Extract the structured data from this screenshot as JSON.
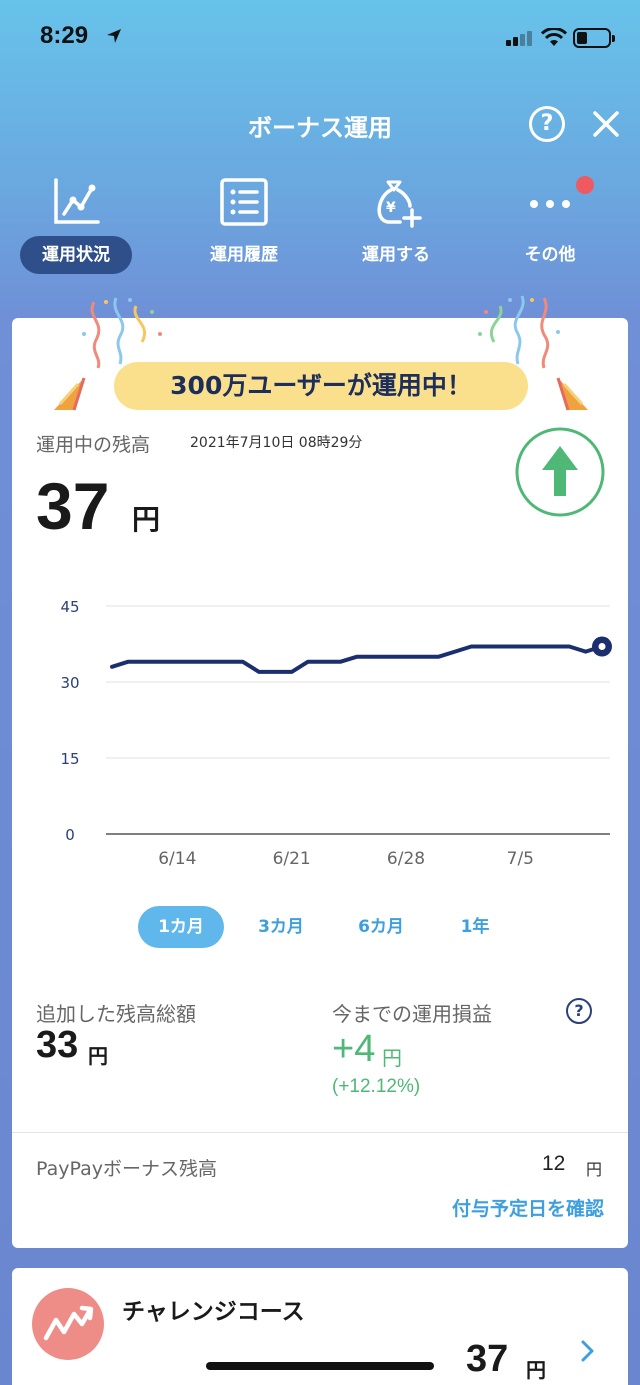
{
  "status_bar": {
    "time": "8:29"
  },
  "header": {
    "title": "ボーナス運用",
    "help": "?"
  },
  "nav": {
    "items": [
      {
        "label": "運用状況",
        "active": true,
        "icon": "line-chart-icon"
      },
      {
        "label": "運用履歴",
        "active": false,
        "icon": "list-icon"
      },
      {
        "label": "運用する",
        "active": false,
        "icon": "money-bag-plus-icon"
      },
      {
        "label": "その他",
        "active": false,
        "icon": "more-icon"
      }
    ]
  },
  "banner": {
    "text": "300万ユーザーが運用中！"
  },
  "balance": {
    "label": "運用中の残高",
    "date": "2021年7月10日 08時29分",
    "value": "37",
    "unit": "円",
    "trend": "up"
  },
  "chart_data": {
    "type": "line",
    "x": [
      "6/10",
      "6/11",
      "6/12",
      "6/13",
      "6/14",
      "6/15",
      "6/16",
      "6/17",
      "6/18",
      "6/19",
      "6/20",
      "6/21",
      "6/22",
      "6/23",
      "6/24",
      "6/25",
      "6/26",
      "6/27",
      "6/28",
      "6/29",
      "6/30",
      "7/1",
      "7/2",
      "7/3",
      "7/4",
      "7/5",
      "7/6",
      "7/7",
      "7/8",
      "7/9",
      "7/10"
    ],
    "series": [
      {
        "values": [
          33,
          34,
          34,
          34,
          34,
          34,
          34,
          34,
          34,
          32,
          32,
          32,
          34,
          34,
          34,
          35,
          35,
          35,
          35,
          35,
          35,
          36,
          37,
          37,
          37,
          37,
          37,
          37,
          37,
          36,
          37
        ]
      }
    ],
    "x_tick_labels": [
      "6/14",
      "6/21",
      "6/28",
      "7/5"
    ],
    "y_ticks": [
      0,
      15,
      30,
      45
    ],
    "ylim": [
      0,
      45
    ],
    "grid": true,
    "line_color": "#1b2f6e"
  },
  "periods": [
    {
      "label": "1カ月",
      "active": true
    },
    {
      "label": "3カ月",
      "active": false
    },
    {
      "label": "6カ月",
      "active": false
    },
    {
      "label": "1年",
      "active": false
    }
  ],
  "stats": {
    "added_label": "追加した残高総額",
    "added_value": "33",
    "added_unit": "円",
    "gain_label": "今までの運用損益",
    "gain_value": "+4",
    "gain_unit": "円",
    "gain_pct": "(+12.12%)",
    "help": "?"
  },
  "paypay": {
    "label": "PayPayボーナス残高",
    "value": "12",
    "unit": "円",
    "link": "付与予定日を確認"
  },
  "course": {
    "name": "チャレンジコース",
    "value": "37",
    "unit": "円"
  },
  "colors": {
    "accent_blue": "#3e9fde",
    "gain_green": "#4fb877",
    "nav_active": "#2f4f8a",
    "banner_yellow": "#fadf8c",
    "notification_red": "#ee5a62"
  }
}
